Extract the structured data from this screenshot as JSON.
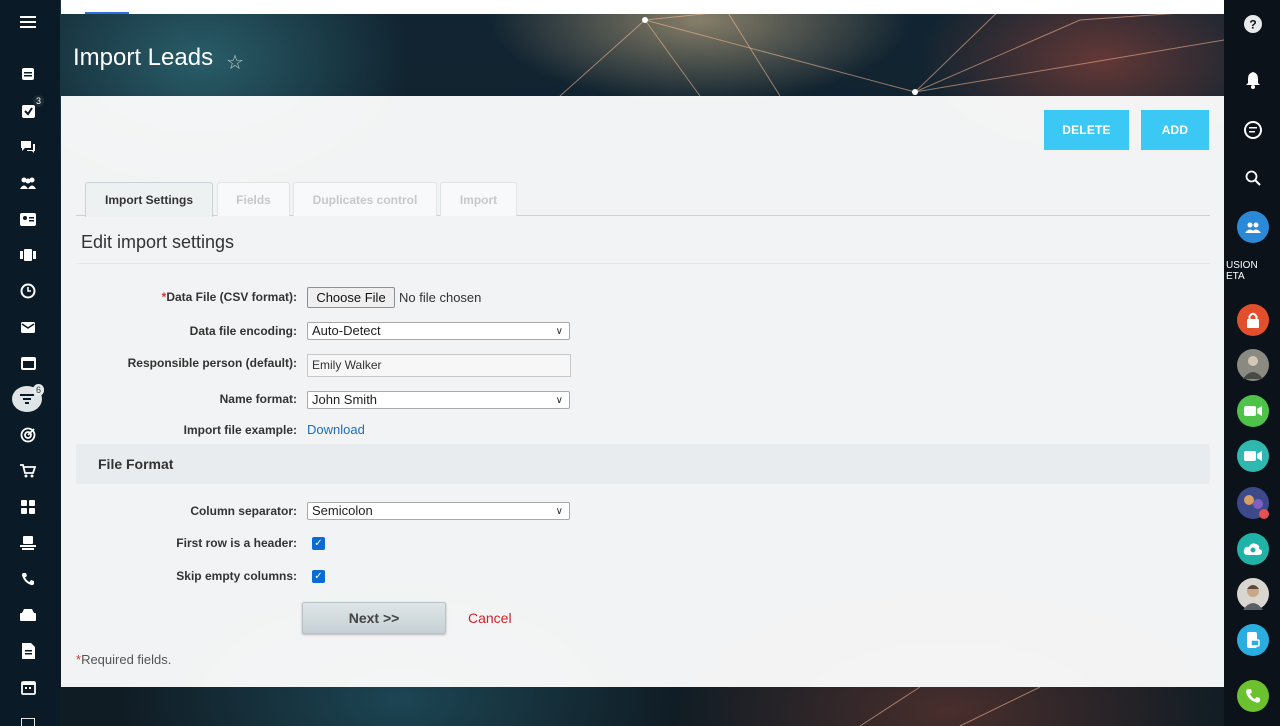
{
  "page": {
    "title": "Import Leads"
  },
  "toolbar": {
    "delete_label": "DELETE",
    "add_label": "ADD"
  },
  "tabs": [
    {
      "label": "Import Settings",
      "active": true
    },
    {
      "label": "Fields",
      "active": false
    },
    {
      "label": "Duplicates control",
      "active": false
    },
    {
      "label": "Import",
      "active": false
    }
  ],
  "section_title": "Edit import settings",
  "form": {
    "data_file": {
      "label": "Data File (CSV format):",
      "required_mark": "*",
      "button": "Choose File",
      "status": "No file chosen"
    },
    "encoding": {
      "label": "Data file encoding:",
      "value": "Auto-Detect"
    },
    "responsible": {
      "label": "Responsible person (default):",
      "value": "Emily Walker"
    },
    "name_format": {
      "label": "Name format:",
      "value": "John Smith"
    },
    "example": {
      "label": "Import file example:",
      "link": "Download"
    }
  },
  "file_format": {
    "title": "File Format",
    "separator": {
      "label": "Column separator:",
      "value": "Semicolon"
    },
    "first_row_header": {
      "label": "First row is a header:",
      "checked": true
    },
    "skip_empty": {
      "label": "Skip empty columns:",
      "checked": true
    }
  },
  "actions": {
    "next_label": "Next >>",
    "cancel_label": "Cancel"
  },
  "footer": {
    "required_mark": "*",
    "required_note": "Required fields."
  },
  "left_nav": {
    "tasks_badge": "3",
    "filter_badge": "6"
  },
  "right_nav": {
    "promo_text_1": "USION",
    "promo_text_2": "ETA"
  },
  "colors": {
    "accent": "#3bc8f5",
    "link": "#1b6ec2",
    "cancel": "#d3232a",
    "checkbox": "#0b6bd5"
  }
}
